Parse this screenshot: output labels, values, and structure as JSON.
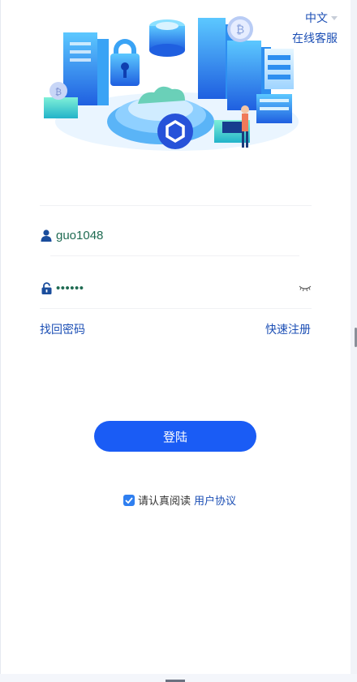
{
  "header": {
    "language_label": "中文",
    "service_label": "在线客服"
  },
  "form": {
    "username_value": "guo1048",
    "password_masked": "••••••",
    "forgot_password_label": "找回密码",
    "register_label": "快速注册",
    "login_button_label": "登陆"
  },
  "agreement": {
    "checked": true,
    "text": "请认真阅读",
    "link_label": "用户协议"
  },
  "icons": {
    "user": "user-icon",
    "lock": "lock-icon",
    "eye": "eye-closed-icon",
    "caret": "chevron-down-icon",
    "check": "check-icon"
  },
  "colors": {
    "accent": "#1a5cf5",
    "link": "#1c4fb5",
    "input_text": "#1f6b52"
  }
}
